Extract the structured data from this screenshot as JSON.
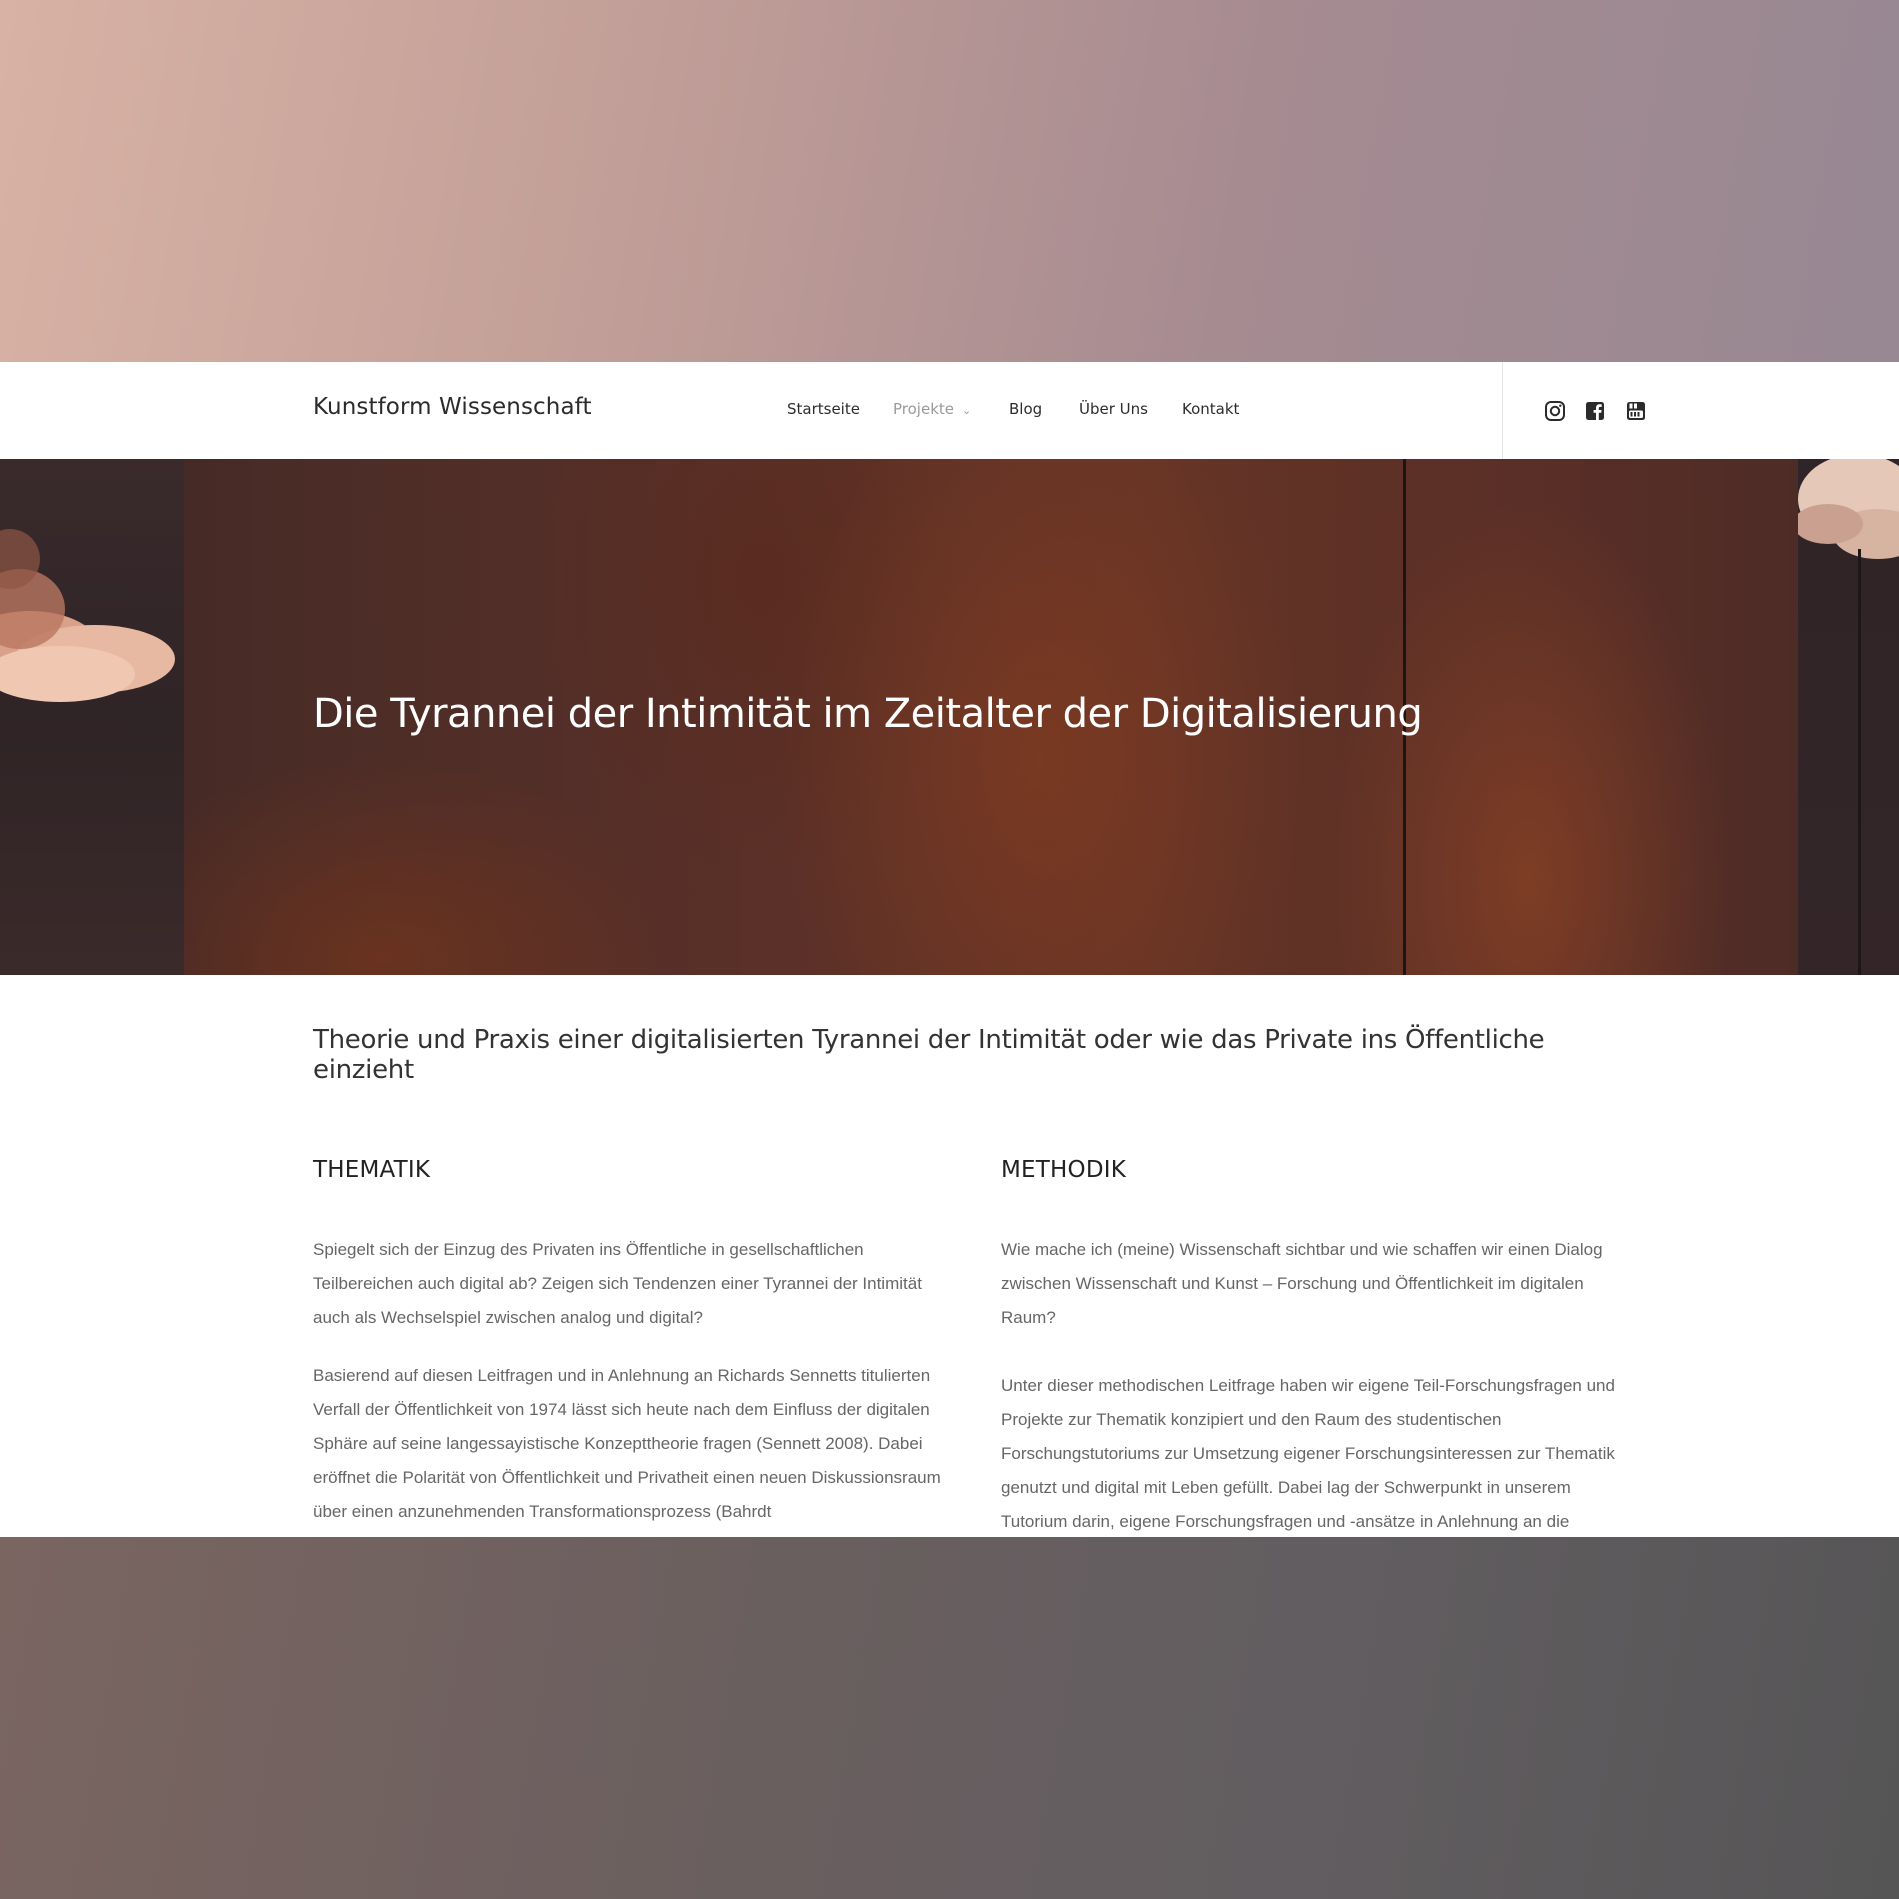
{
  "header": {
    "brand": "Kunstform Wissenschaft",
    "nav": [
      {
        "label": "Startseite",
        "active": false
      },
      {
        "label": "Projekte",
        "active": true,
        "has_dropdown": true
      },
      {
        "label": "Blog",
        "active": false
      },
      {
        "label": "Über Uns",
        "active": false
      },
      {
        "label": "Kontakt",
        "active": false
      }
    ],
    "social_icons": [
      "instagram-icon",
      "facebook-icon",
      "youtube-icon"
    ]
  },
  "hero": {
    "title": "Die Tyrannei der Intimität im Zeitalter der Digitalisierung"
  },
  "lead": "Theorie und Praxis einer digitalisierten Tyrannei der Intimität oder wie das Private ins Öffentliche einzieht",
  "columns": [
    {
      "heading": "THEMATIK",
      "paragraphs": [
        "Spiegelt sich der Einzug des Privaten ins Öffentliche in gesellschaftlichen Teilbereichen auch digital ab? Zeigen sich Tendenzen einer Tyrannei der Intimität auch als Wechselspiel zwischen analog und digital?",
        "Basierend auf diesen Leitfragen und in Anlehnung an Richards Sennetts titulierten Verfall der Öffentlichkeit von 1974 lässt sich heute nach dem Einfluss der digitalen Sphäre auf seine langessayistische Konzepttheorie fragen (Sennett 2008). Dabei eröffnet die Polarität von Öffentlichkeit und Privatheit einen neuen Diskussionsraum über einen anzunehmenden Transformationsprozess (Bahrdt"
      ]
    },
    {
      "heading": "METHODIK",
      "paragraphs": [
        "Wie mache ich (meine) Wissenschaft sichtbar und wie schaffen wir einen Dialog zwischen Wissenschaft und Kunst – Forschung und Öffentlichkeit im digitalen Raum?",
        "Unter dieser methodischen Leitfrage haben wir eigene Teil-Forschungsfragen und Projekte zur Thematik konzipiert und den Raum des studentischen Forschungstutoriums zur Umsetzung eigener Forschungsinteressen zur Thematik genutzt und digital mit Leben gefüllt. Dabei lag der Schwerpunkt in unserem Tutorium darin, eigene Forschungsfragen und -ansätze in Anlehnung an die"
      ]
    }
  ],
  "colors": {
    "background_top": "#c4a098",
    "background_bottom": "#625d5f",
    "hero_base": "#5a3028",
    "text_dark": "#2b2b2b",
    "text_body": "#666666",
    "nav_active": "#9a9a9a"
  }
}
